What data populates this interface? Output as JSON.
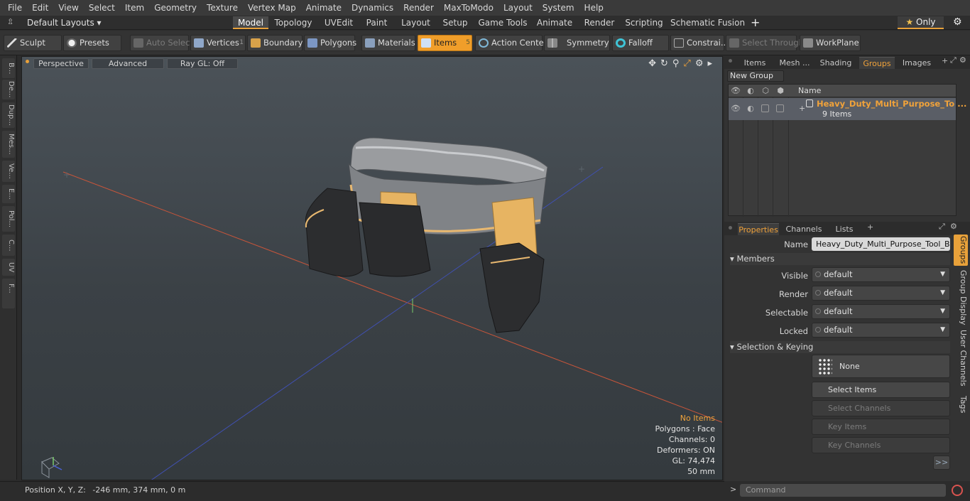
{
  "menu": [
    "File",
    "Edit",
    "View",
    "Select",
    "Item",
    "Geometry",
    "Texture",
    "Vertex Map",
    "Animate",
    "Dynamics",
    "Render",
    "MaxToModo",
    "Layout",
    "System",
    "Help"
  ],
  "layout": {
    "preset": "Default Layouts",
    "tabs": [
      "Model",
      "Topology",
      "UVEdit",
      "Paint",
      "Layout",
      "Setup",
      "Game Tools",
      "Animate",
      "Render",
      "Scripting",
      "Schematic Fusion"
    ],
    "active_tab": "Model",
    "add": "+",
    "only_label": "Only",
    "star": "★",
    "gear": "⚙"
  },
  "toolbar": {
    "sculpt": "Sculpt",
    "presets": "Presets",
    "auto_select": "Auto Select",
    "vertices": "Vertices",
    "vertices_count": "1",
    "boundary": "Boundary",
    "polygons": "Polygons",
    "materials": "Materials",
    "items": "Items",
    "items_count": "5",
    "action_center": "Action Center",
    "symmetry": "Symmetry",
    "falloff": "Falloff",
    "constraints": "Constrai...",
    "select_through": "Select Through",
    "workplane": "WorkPlane"
  },
  "left_strip": [
    "B...",
    "De...",
    "Dup...",
    "Mes...",
    "Ve...",
    "E...",
    "Pol...",
    "C...",
    "UV",
    "F..."
  ],
  "viewport": {
    "view": "Perspective",
    "shading": "Advanced",
    "raygl": "Ray GL: Off",
    "stats": {
      "items": "No Items",
      "polygons": "Polygons : Face",
      "channels": "Channels: 0",
      "deformers": "Deformers: ON",
      "gl": "GL: 74,474",
      "scale": "50 mm"
    }
  },
  "status": {
    "label": "Position X, Y, Z:",
    "value": "-246 mm, 374 mm, 0 m"
  },
  "panel_top": {
    "tabs": [
      "Items",
      "Mesh ...",
      "Shading",
      "Groups",
      "Images"
    ],
    "active": "Groups",
    "new_group": "New Group",
    "col_name": "Name",
    "group_name": "Heavy_Duty_Multi_Purpose_To ...",
    "group_count": "9 Items"
  },
  "properties": {
    "tabs": [
      "Properties",
      "Channels",
      "Lists"
    ],
    "active": "Properties",
    "name_label": "Name",
    "name_value": "Heavy_Duty_Multi_Purpose_Tool_Belt",
    "members": "Members",
    "visible_label": "Visible",
    "visible_value": "default",
    "render_label": "Render",
    "render_value": "default",
    "selectable_label": "Selectable",
    "selectable_value": "default",
    "locked_label": "Locked",
    "locked_value": "default",
    "sel_keying": "Selection & Keying",
    "none": "None",
    "select_items": "Select Items",
    "select_channels": "Select Channels",
    "key_items": "Key Items",
    "key_channels": "Key Channels",
    "more": ">>"
  },
  "side_tabs": [
    "Groups",
    "Group Display",
    "User Channels",
    "Tags"
  ],
  "command_placeholder": "Command",
  "colors": {
    "accent": "#f09e2a",
    "selected_row": "#5a5e66"
  }
}
